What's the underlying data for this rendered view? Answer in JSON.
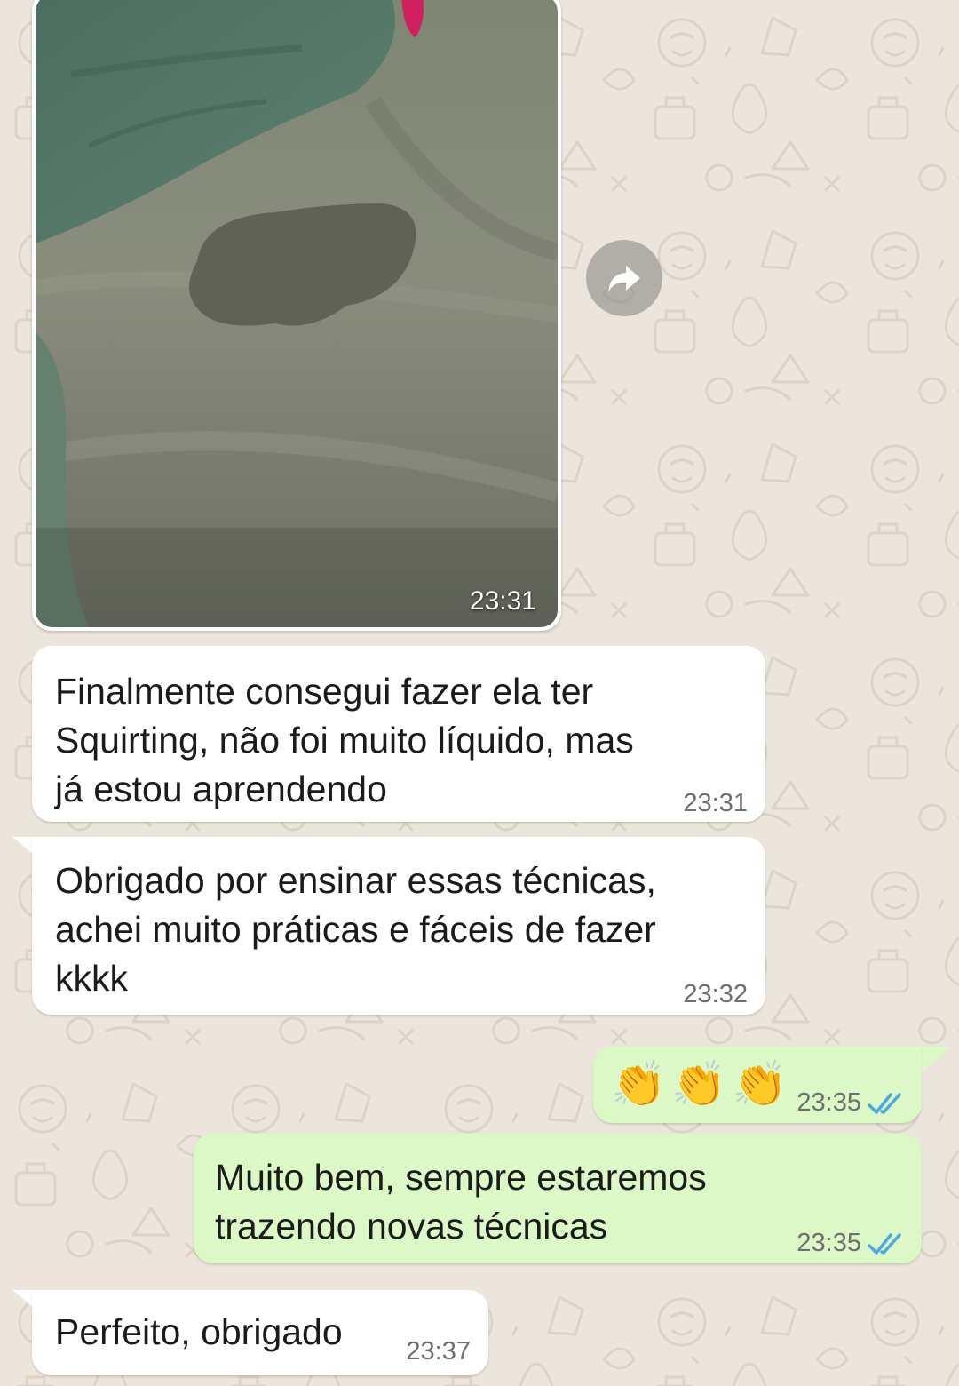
{
  "chat": {
    "messages": [
      {
        "id": "m1",
        "direction": "incoming",
        "type": "image",
        "time": "23:31"
      },
      {
        "id": "m2",
        "direction": "incoming",
        "type": "text",
        "text": "Finalmente consegui fazer ela ter\nSquirting, não foi muito líquido, mas\njá estou aprendendo",
        "time": "23:31"
      },
      {
        "id": "m3",
        "direction": "incoming",
        "type": "text",
        "text": "Obrigado por ensinar essas técnicas,\nachei muito práticas e fáceis de fazer\nkkkk",
        "time": "23:32"
      },
      {
        "id": "m4",
        "direction": "outgoing",
        "type": "emoji",
        "text": "👏👏👏",
        "time": "23:35",
        "status": "read"
      },
      {
        "id": "m5",
        "direction": "outgoing",
        "type": "text",
        "text": "Muito bem, sempre estaremos\ntrazendo novas técnicas",
        "time": "23:35",
        "status": "read"
      },
      {
        "id": "m6",
        "direction": "incoming",
        "type": "text",
        "text": "Perfeito, obrigado",
        "time": "23:37"
      }
    ],
    "icons": {
      "forward": "forward-icon",
      "read_receipt": "double-check-icon"
    },
    "colors": {
      "background": "#ECE5DB",
      "incoming_bubble": "#FFFFFF",
      "outgoing_bubble": "#DCF8C6",
      "read_ticks": "#4FA8E0",
      "timestamp": "#6F6F6F"
    }
  }
}
